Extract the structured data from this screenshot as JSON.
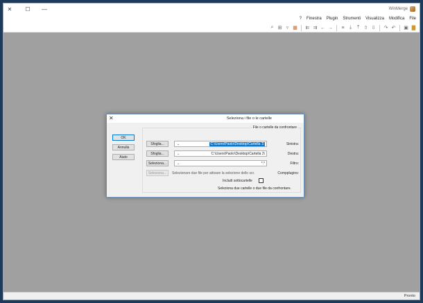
{
  "window": {
    "title": "WinMerge",
    "controls": {
      "close": "✕",
      "maximize": "☐",
      "minimize": "—"
    }
  },
  "menu": [
    "File",
    "Modifica",
    "Visualizza",
    "Strumenti",
    "Plugin",
    "Finestra",
    "?"
  ],
  "toolbar": {
    "icons": [
      "open-icon",
      "save-icon",
      "undo-icon",
      "redo-icon",
      "next-diff-icon",
      "prev-diff-icon",
      "first-diff-icon",
      "last-diff-icon",
      "current-diff-icon",
      "copy-right-icon",
      "copy-left-icon",
      "copy-all-right-icon",
      "copy-all-left-icon",
      "options-icon",
      "filter-icon",
      "compare-icon",
      "refresh-icon",
      "zoom-icon"
    ]
  },
  "dialog": {
    "title": "Seleziona i file o le cartelle",
    "close": "✕",
    "buttons": {
      "ok": "OK",
      "cancel": "Annulla",
      "help": "Aiuto"
    },
    "group_label": "File o cartelle da confrontare",
    "left": {
      "label": "Sinistra:",
      "value": "C:\\Users\\Paolo\\Desktop\\Cartella 1\\",
      "browse": "Sfoglia..."
    },
    "right": {
      "label": "Destra:",
      "value": "C:\\Users\\Paolo\\Desktop\\Cartella 2\\",
      "browse": "Sfoglia..."
    },
    "filter": {
      "label": "Filtro:",
      "value": "*.*",
      "button": "Seleziona..."
    },
    "compare_plugin": {
      "label": "Compplugins:",
      "hint": "Selezionare due file per attivare la selezione dello scr.",
      "button": "Seleziona..."
    },
    "include_subfolders": {
      "label": "Includi sottocartelle",
      "checked": false
    },
    "status": "Seleziona due cartelle o due file da confrontare."
  },
  "statusbar": {
    "text": "Pronto"
  }
}
